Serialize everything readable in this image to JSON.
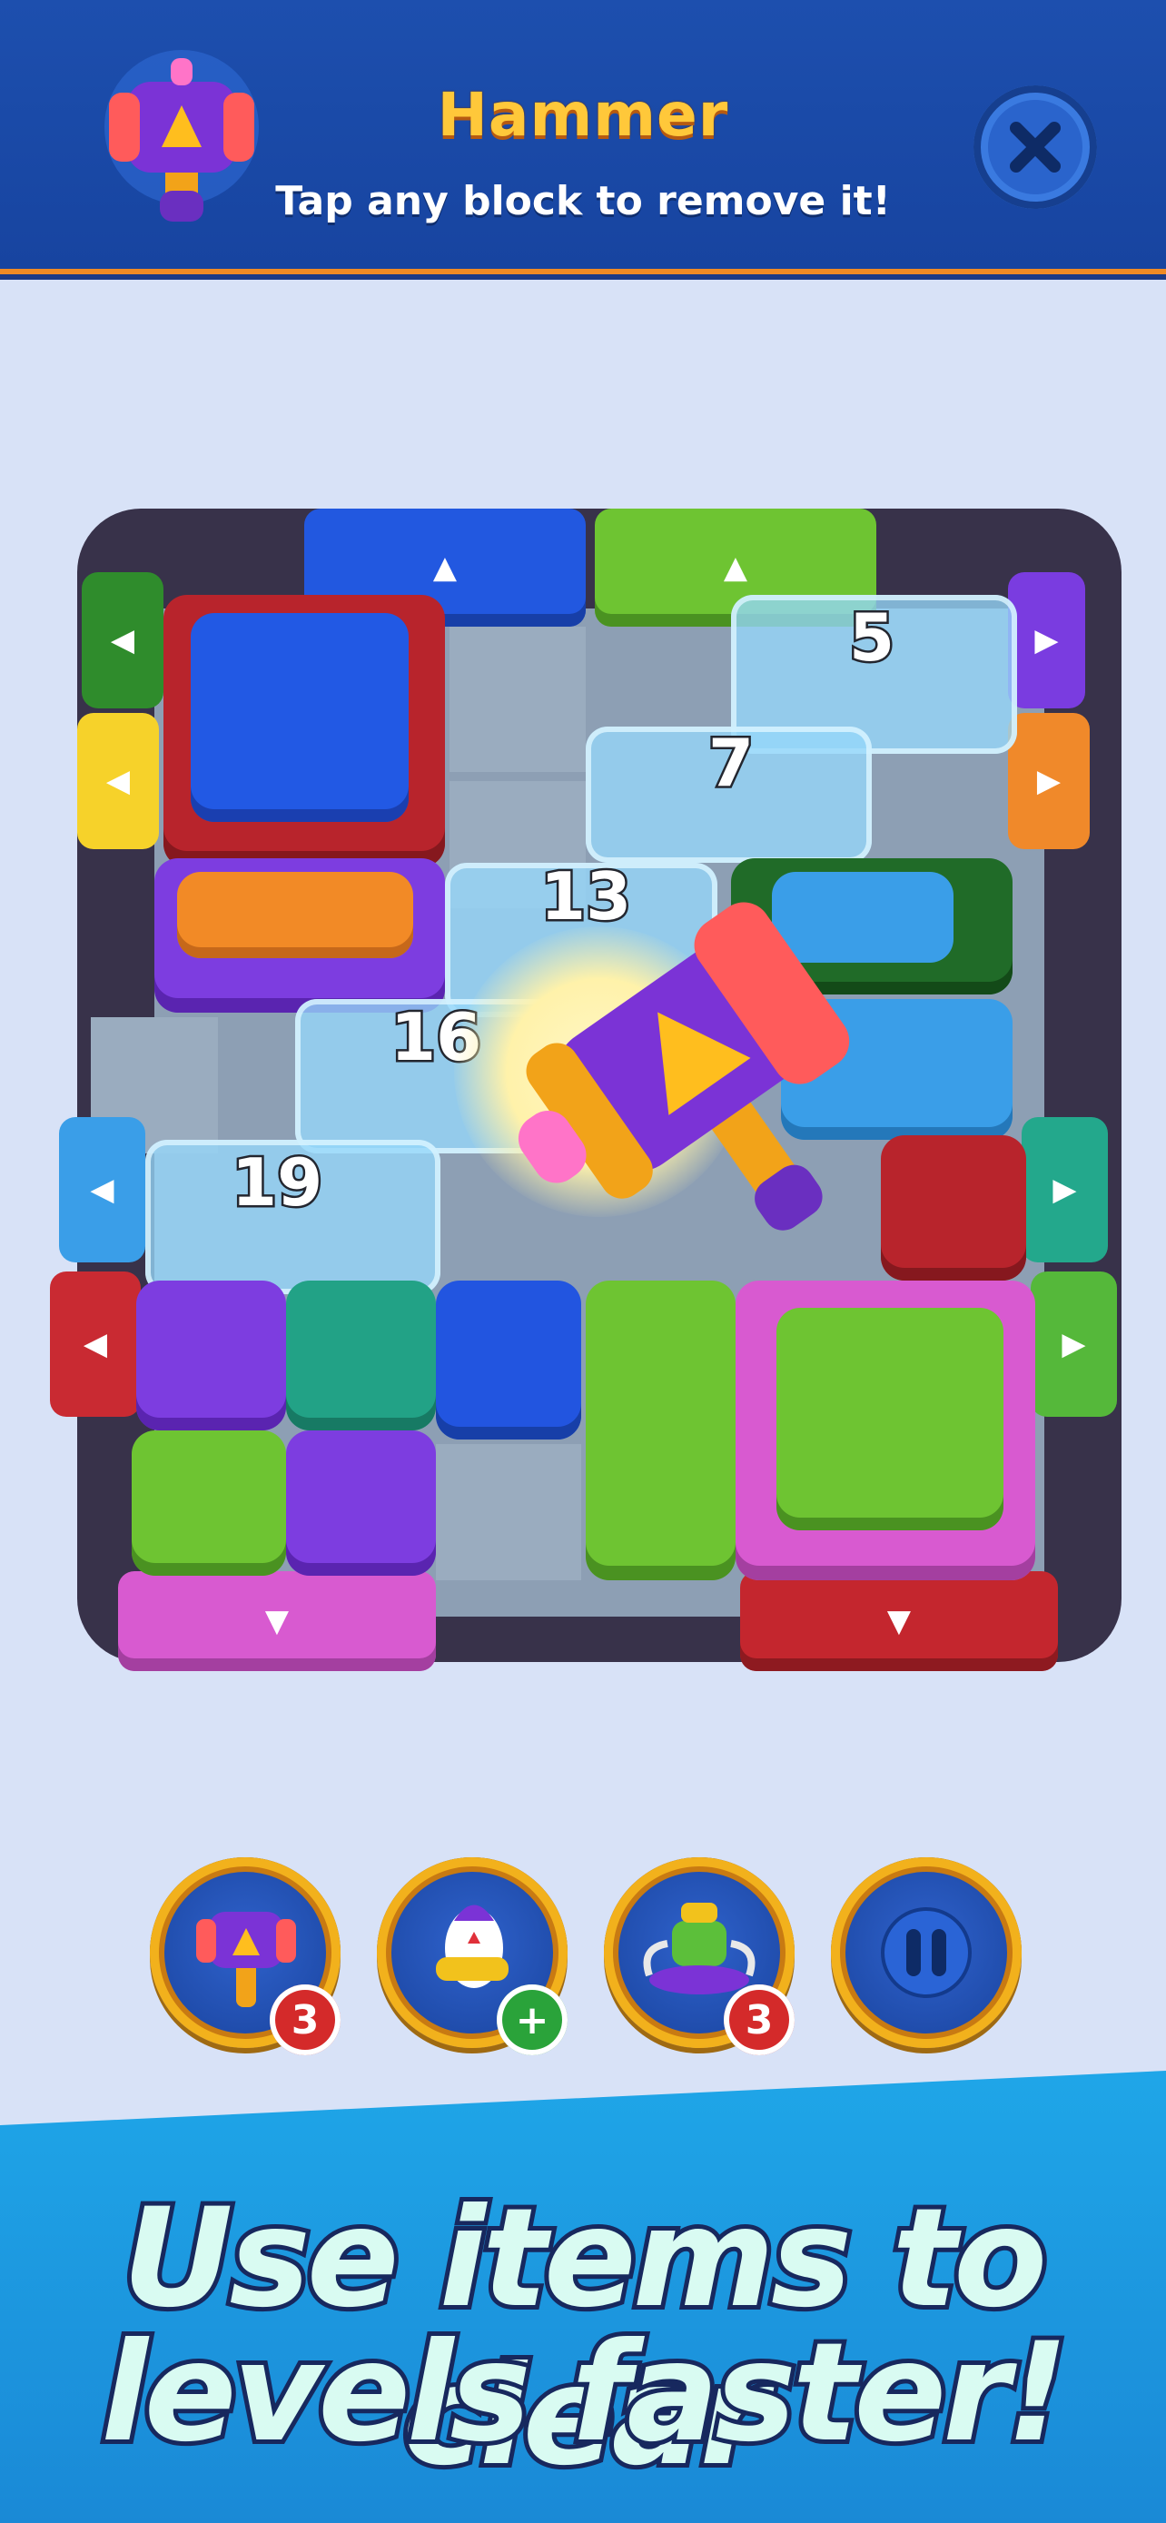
{
  "header": {
    "title": "Hammer",
    "subtitle": "Tap any block to remove it!",
    "close_icon": "close-x-icon"
  },
  "board": {
    "ice_counters": [
      "5",
      "7",
      "13",
      "16",
      "19"
    ]
  },
  "toolbar": {
    "items": [
      {
        "name": "hammer-booster",
        "icon": "hammer-icon",
        "badge": "3",
        "badge_color": "#d42a2a"
      },
      {
        "name": "rocket-booster",
        "icon": "rocket-icon",
        "badge": "+",
        "badge_color": "#2aa33a"
      },
      {
        "name": "vacuum-booster",
        "icon": "vacuum-icon",
        "badge": "3",
        "badge_color": "#d42a2a"
      },
      {
        "name": "pause-button",
        "icon": "pause-icon",
        "badge": "",
        "badge_color": ""
      }
    ]
  },
  "banner": {
    "line1": "Use items to clear",
    "line2": "levels faster!"
  },
  "colors": {
    "header_bg": "#1d4fae",
    "title": "#ffc83a",
    "accent_orange": "#f08a24",
    "banner_bg": "#1fa6e8"
  }
}
